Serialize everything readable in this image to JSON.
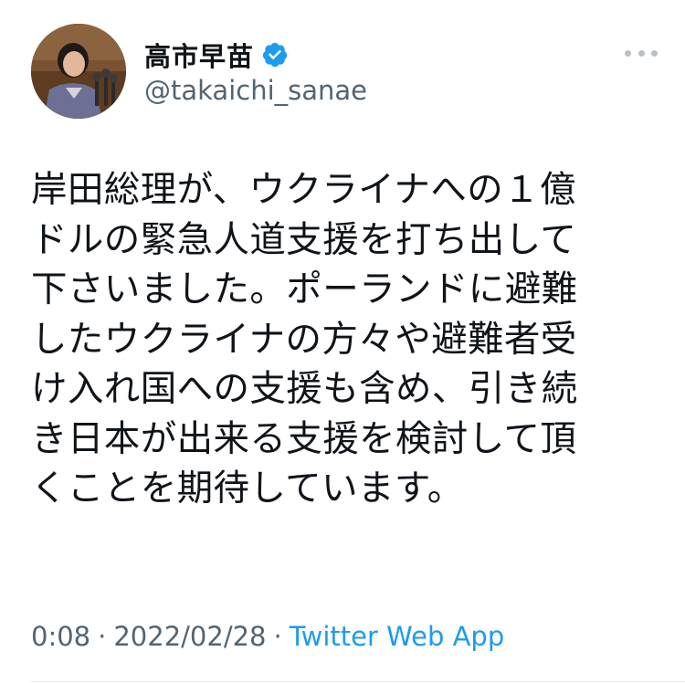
{
  "tweet": {
    "display_name": "高市早苗",
    "handle": "@takaichi_sanae",
    "verified_icon": "verified-badge-icon",
    "more_icon": "more-options-icon",
    "text": "岸田総理が、ウクライナへの１億\nドルの緊急人道支援を打ち出して\n下さいました。ポーランドに避難\nしたウクライナの方々や避難者受\nけ入れ国への支援も含め、引き続\nき日本が出来る支援を検討して頂\nくことを期待しています。",
    "time": "0:08",
    "separator": "·",
    "date": "2022/02/28",
    "source": "Twitter Web App"
  },
  "colors": {
    "text": "#0f1419",
    "secondary": "#536471",
    "accent": "#1d9bf0",
    "more_dots": "#b9c0c6"
  }
}
